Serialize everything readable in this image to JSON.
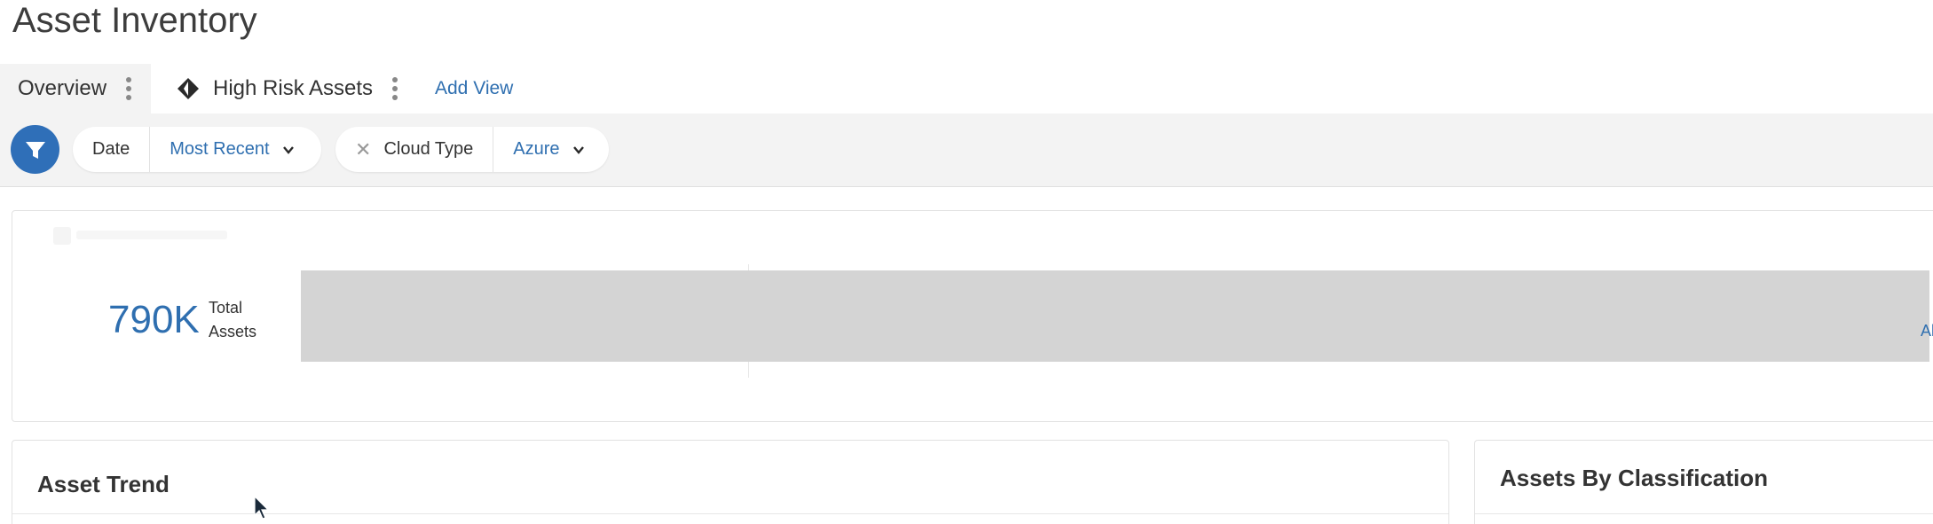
{
  "page": {
    "title": "Asset Inventory"
  },
  "tabs": [
    {
      "label": "Overview",
      "active": true
    },
    {
      "label": "High Risk Assets",
      "icon": "risk-diamond-icon"
    },
    {
      "label": "Add View"
    }
  ],
  "filters": {
    "icon": "filter-icon",
    "date": {
      "label": "Date",
      "value": "Most Recent"
    },
    "cloud_type": {
      "label": "Cloud Type",
      "value": "Azure",
      "remove_icon": "close-icon"
    }
  },
  "summary": {
    "total_value": "790K",
    "total_label": "Total Assets",
    "edge_text": "Al"
  },
  "panels": {
    "asset_trend": {
      "title": "Asset Trend"
    },
    "assets_by_classification": {
      "title": "Assets By Classification"
    }
  },
  "colors": {
    "accent": "#2f6fb0",
    "filter_button": "#2f6fb8",
    "bar_placeholder": "#d4d4d4",
    "filter_bar_bg": "#f3f3f3"
  }
}
